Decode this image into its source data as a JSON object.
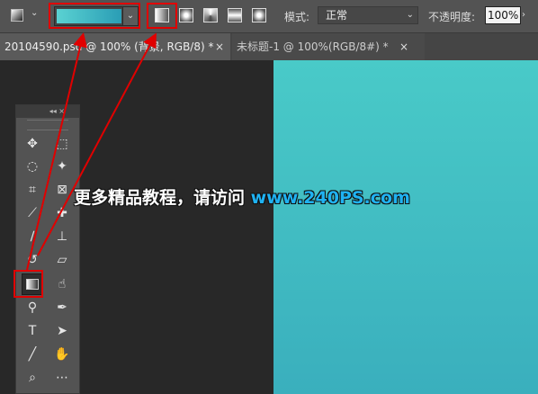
{
  "options_bar": {
    "tool_preset_icon": "gradient-tool-preset-icon",
    "gradient_picker": {
      "swatch_colors": [
        "#5ad2d2",
        "#2a9db5"
      ],
      "dropdown_icon": "chevron-down-icon"
    },
    "gradient_types": [
      {
        "name": "linear-gradient-icon"
      },
      {
        "name": "radial-gradient-icon"
      },
      {
        "name": "angle-gradient-icon"
      },
      {
        "name": "reflected-gradient-icon"
      },
      {
        "name": "diamond-gradient-icon"
      }
    ],
    "mode_label": "模式:",
    "mode_value": "正常",
    "opacity_label": "不透明度:",
    "opacity_value": "100%"
  },
  "tabs": [
    {
      "label": "20104590.psd @ 100% (背景, RGB/8) *",
      "close": "×"
    },
    {
      "label": "未标题-1 @ 100%(RGB/8#) *",
      "close": "×"
    }
  ],
  "toolbox": {
    "collapse_glyph": "◂◂",
    "close_glyph": "×"
  },
  "watermark": {
    "text": "更多精品教程，请访问 ",
    "site": "www.240PS.com"
  },
  "colors": {
    "highlight": "#e00000",
    "canvas_top": "#49cac8",
    "canvas_bottom": "#3aafbd",
    "watermark_site": "#1fb2f2"
  }
}
